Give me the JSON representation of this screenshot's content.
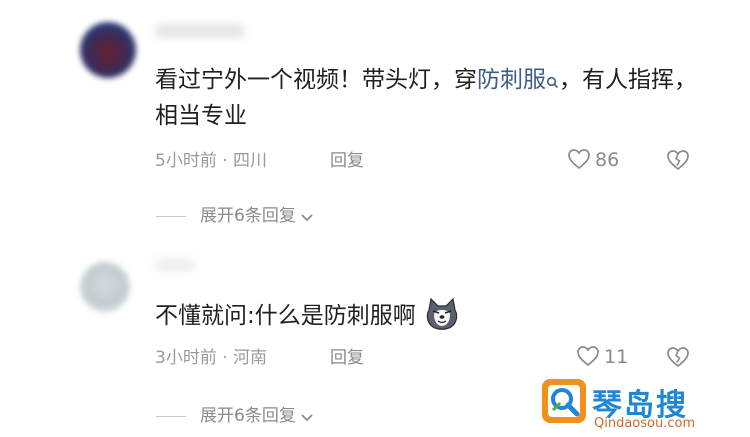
{
  "comments": [
    {
      "text_before": "看过宁外一个视频！带头灯，穿",
      "link_text": "防刺服",
      "text_after": "，有人指挥，相当专业",
      "time": "5小时前",
      "separator": " · ",
      "location": "四川",
      "reply_label": "回复",
      "like_count": "86",
      "expand_label": "展开6条回复"
    },
    {
      "text": "不懂就问:什么是防刺服啊",
      "emoji_icon": "dog-face-icon",
      "time": "3小时前",
      "separator": " · ",
      "location": "河南",
      "reply_label": "回复",
      "like_count": "11",
      "expand_label": "展开6条回复"
    }
  ],
  "watermark": {
    "brand": "琴岛搜",
    "url": "Qindaosou.com"
  },
  "colors": {
    "link": "#3d5c8a",
    "meta": "#9a9a9a",
    "text": "#1f1f1f",
    "watermark_blue": "#1e86d6",
    "watermark_orange": "#f2901e"
  }
}
